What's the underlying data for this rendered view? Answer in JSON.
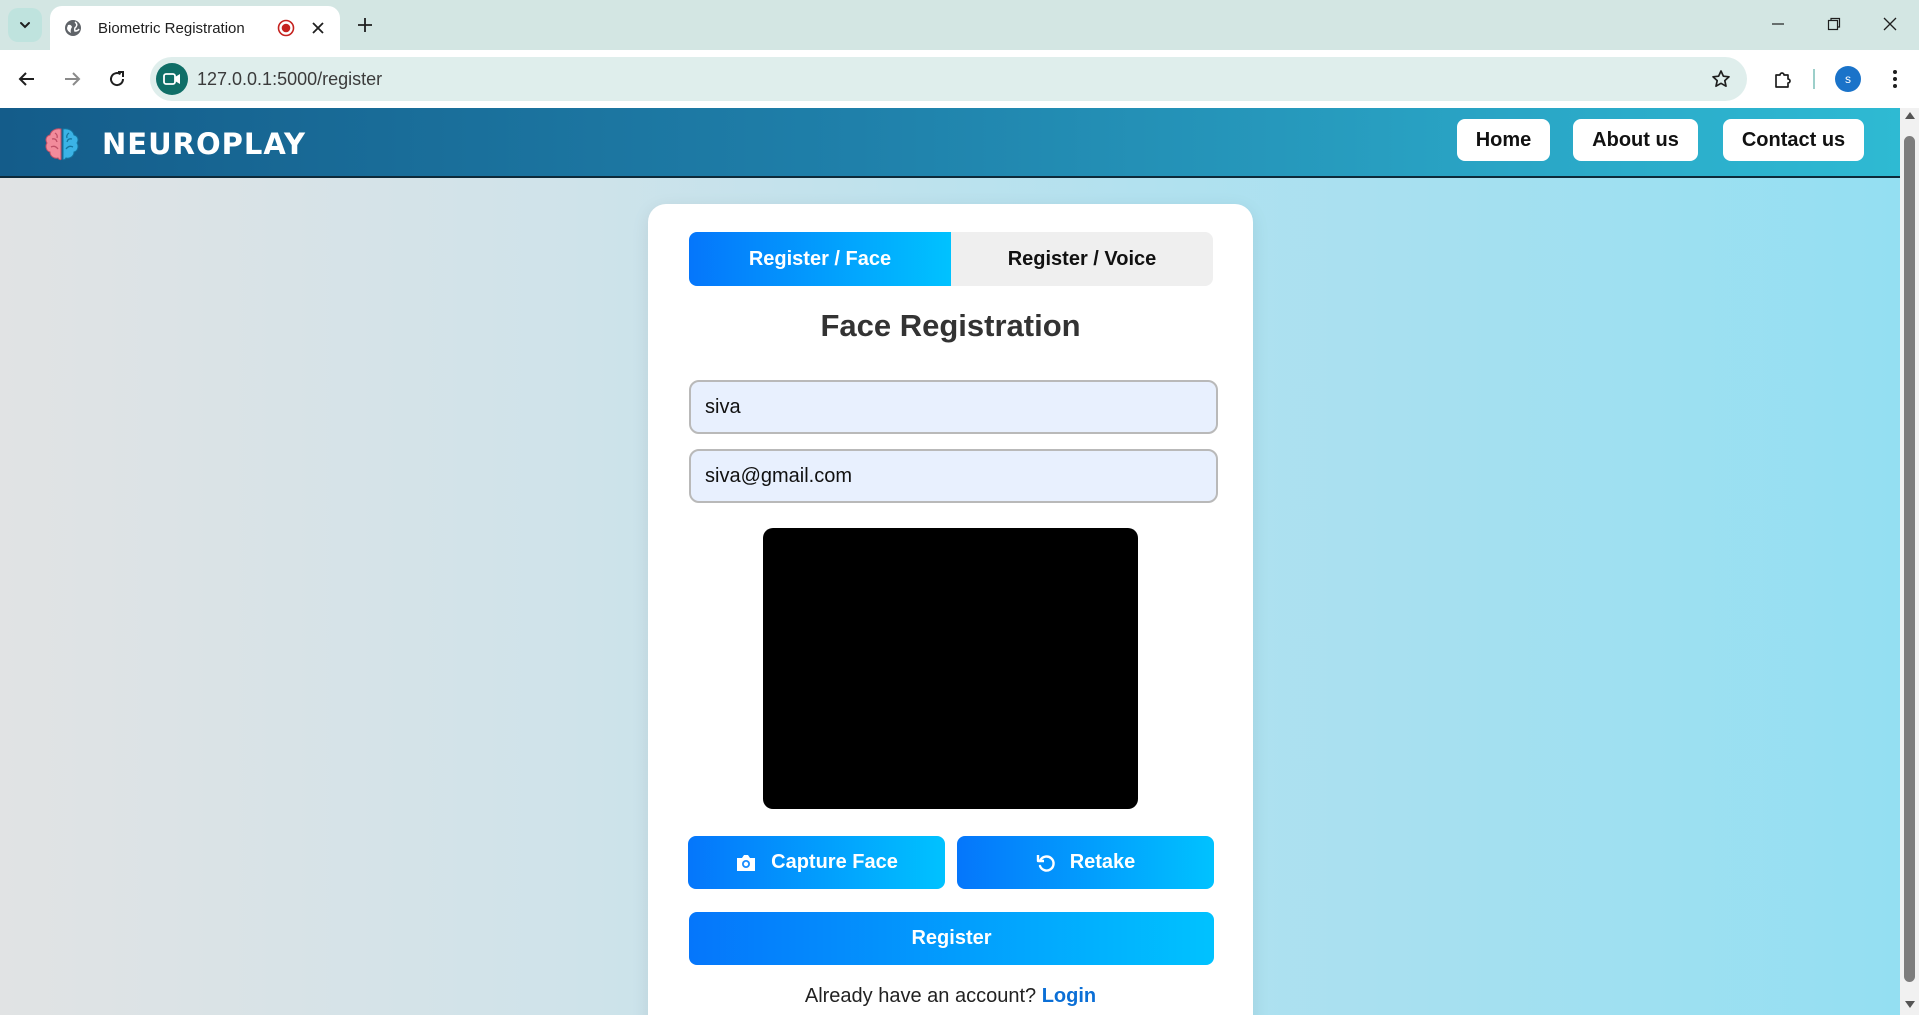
{
  "browser": {
    "tab_title": "Biometric Registration",
    "url": "127.0.0.1:5000/register",
    "avatar_initial": "s"
  },
  "navbar": {
    "brand": "NEUROPLAY",
    "links": [
      "Home",
      "About us",
      "Contact us"
    ]
  },
  "form": {
    "tabs": [
      "Register / Face",
      "Register / Voice"
    ],
    "active_tab": "Register / Face",
    "title": "Face Registration",
    "name_value": "siva",
    "email_value": "siva@gmail.com",
    "capture_label": "Capture Face",
    "retake_label": "Retake",
    "register_label": "Register",
    "login_prompt": "Already have an account?",
    "login_link": "Login"
  },
  "colors": {
    "accent_gradient_start": "#0576fb",
    "accent_gradient_end": "#00c2ff",
    "navbar_start": "#145c8a",
    "navbar_end": "#2ebad3",
    "login_link": "#0b6fd6"
  },
  "icons": {
    "tab_search": "chevron-down-icon",
    "favicon": "globe-icon",
    "recording": "recording-icon",
    "capture": "camera-icon",
    "retake": "rotate-left-icon",
    "brand": "brain-icon"
  }
}
